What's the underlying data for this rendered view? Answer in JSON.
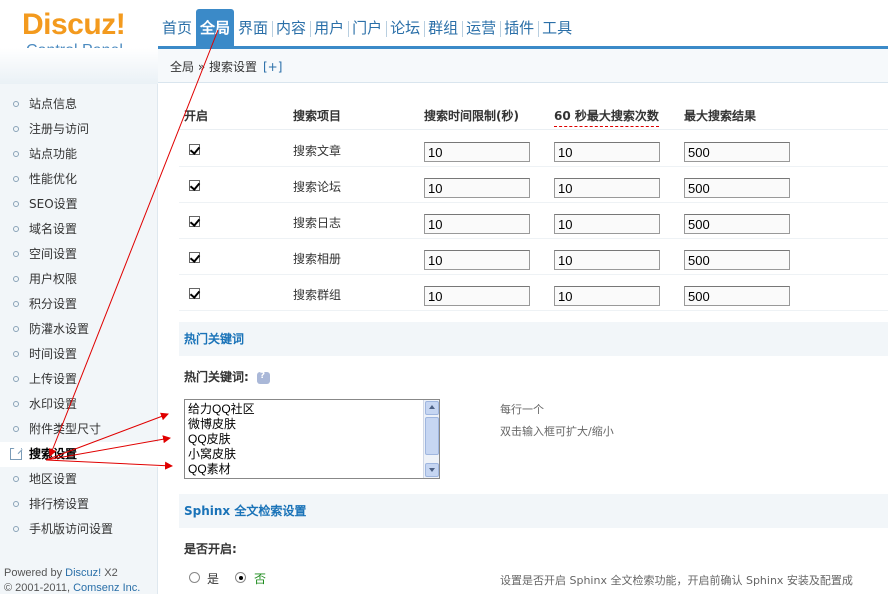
{
  "logo": {
    "main": "Discuz!",
    "sub": "Control Panel"
  },
  "topnav": [
    {
      "label": "首页"
    },
    {
      "label": "全局",
      "active": true
    },
    {
      "label": "界面"
    },
    {
      "label": "内容"
    },
    {
      "label": "用户"
    },
    {
      "label": "门户"
    },
    {
      "label": "论坛"
    },
    {
      "label": "群组"
    },
    {
      "label": "运营"
    },
    {
      "label": "插件"
    },
    {
      "label": "工具"
    }
  ],
  "breadcrumb": {
    "path": "全局 » 搜索设置",
    "add": "[+]"
  },
  "sidebar": {
    "items": [
      {
        "label": "站点信息"
      },
      {
        "label": "注册与访问"
      },
      {
        "label": "站点功能"
      },
      {
        "label": "性能优化"
      },
      {
        "label": "SEO设置"
      },
      {
        "label": "域名设置"
      },
      {
        "label": "空间设置"
      },
      {
        "label": "用户权限"
      },
      {
        "label": "积分设置"
      },
      {
        "label": "防灌水设置"
      },
      {
        "label": "时间设置"
      },
      {
        "label": "上传设置"
      },
      {
        "label": "水印设置"
      },
      {
        "label": "附件类型尺寸"
      },
      {
        "label": "搜索设置",
        "active": true
      },
      {
        "label": "地区设置"
      },
      {
        "label": "排行榜设置"
      },
      {
        "label": "手机版访问设置"
      }
    ],
    "copyright_line1_prefix": "Powered by ",
    "copyright_line1_brand": "Discuz!",
    "copyright_line1_version": " X2",
    "copyright_line2_prefix": "© 2001-2011, ",
    "copyright_line2_company": "Comsenz Inc."
  },
  "table": {
    "headers": [
      "开启",
      "搜索项目",
      "搜索时间限制(秒)",
      "60 秒最大搜索次数",
      "最大搜索结果"
    ],
    "rows": [
      {
        "name": "搜索文章",
        "enabled": true,
        "time": "10",
        "count": "10",
        "max": "500"
      },
      {
        "name": "搜索论坛",
        "enabled": true,
        "time": "10",
        "count": "10",
        "max": "500"
      },
      {
        "name": "搜索日志",
        "enabled": true,
        "time": "10",
        "count": "10",
        "max": "500"
      },
      {
        "name": "搜索相册",
        "enabled": true,
        "time": "10",
        "count": "10",
        "max": "500"
      },
      {
        "name": "搜索群组",
        "enabled": true,
        "time": "10",
        "count": "10",
        "max": "500"
      }
    ]
  },
  "hot": {
    "section_title": "热门关键词",
    "label": "热门关键词:",
    "keywords": [
      "给力QQ社区",
      "微博皮肤",
      "QQ皮肤",
      "小窝皮肤",
      "QQ素材"
    ],
    "tip1": "每行一个",
    "tip2": "双击输入框可扩大/缩小"
  },
  "sphinx": {
    "section_title": "Sphinx 全文检索设置",
    "label": "是否开启:",
    "yes": "是",
    "no": "否",
    "selected": "否",
    "desc": "设置是否开启 Sphinx 全文检索功能，开启前确认 Sphinx 安装及配置成"
  },
  "colors": {
    "accent": "#3b8ac8",
    "logo": "#f39a1e",
    "link": "#2a6fa8",
    "section": "#1a73b8",
    "annotation": "#e00000"
  }
}
